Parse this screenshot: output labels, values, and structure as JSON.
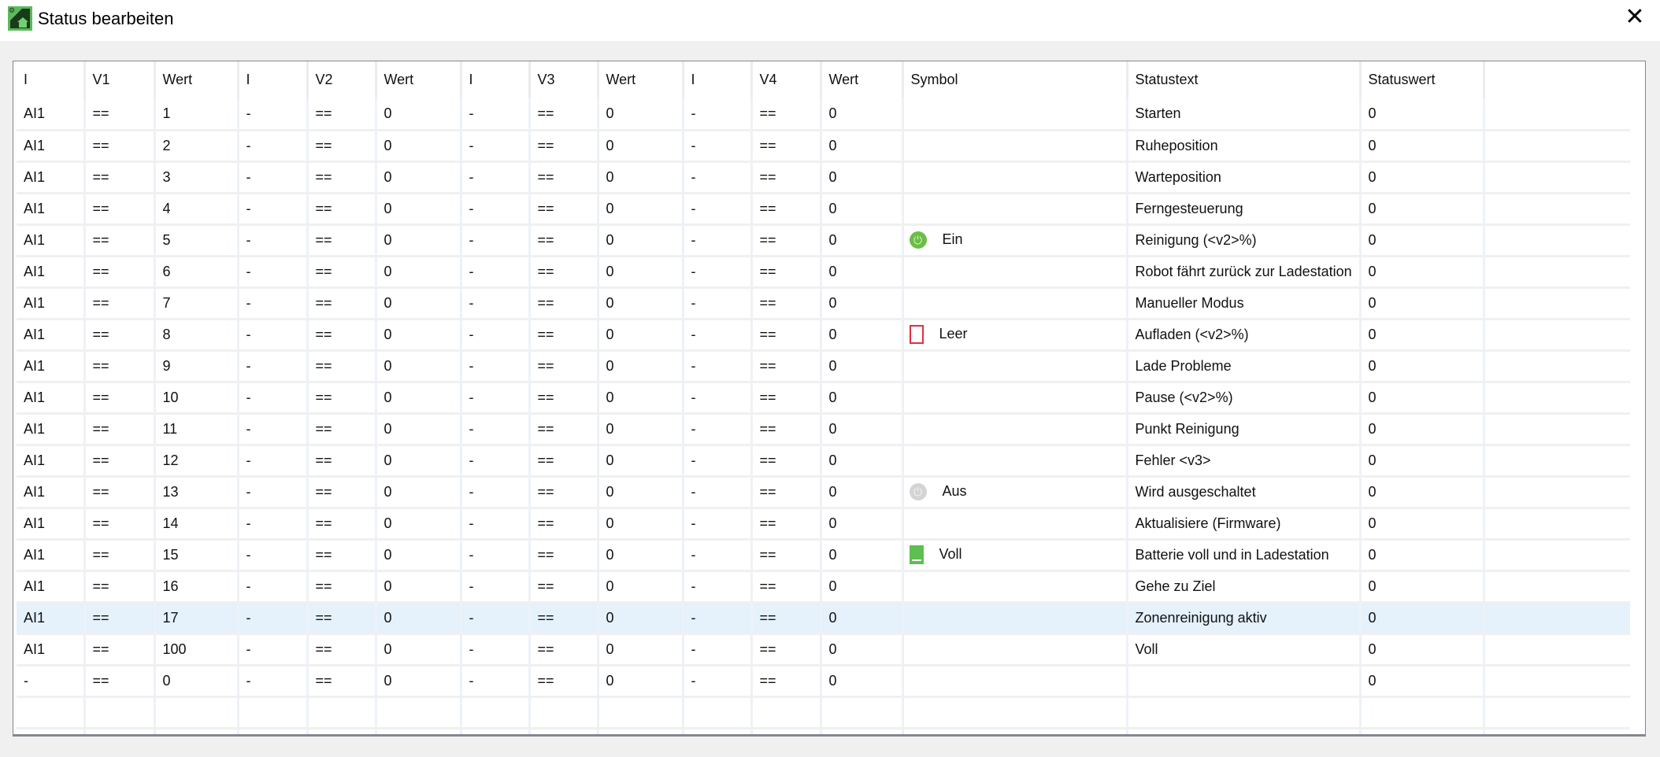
{
  "window": {
    "title": "Status bearbeiten",
    "close_icon": "close-icon"
  },
  "colors": {
    "selected_row": "#e5f1fb",
    "power_on": "#6abf45",
    "battery_empty": "#e03040",
    "battery_full": "#5cbf50"
  },
  "columns": [
    "I",
    "V1",
    "Wert",
    "I",
    "V2",
    "Wert",
    "I",
    "V3",
    "Wert",
    "I",
    "V4",
    "Wert",
    "Symbol",
    "Statustext",
    "Statuswert",
    ""
  ],
  "selected_row": 16,
  "rows": [
    {
      "cells": [
        "AI1",
        "==",
        "1",
        "-",
        "==",
        "0",
        "-",
        "==",
        "0",
        "-",
        "==",
        "0"
      ],
      "symbol": null,
      "text": "Starten",
      "value": "0"
    },
    {
      "cells": [
        "AI1",
        "==",
        "2",
        "-",
        "==",
        "0",
        "-",
        "==",
        "0",
        "-",
        "==",
        "0"
      ],
      "symbol": null,
      "text": "Ruheposition",
      "value": "0"
    },
    {
      "cells": [
        "AI1",
        "==",
        "3",
        "-",
        "==",
        "0",
        "-",
        "==",
        "0",
        "-",
        "==",
        "0"
      ],
      "symbol": null,
      "text": "Warteposition",
      "value": "0"
    },
    {
      "cells": [
        "AI1",
        "==",
        "4",
        "-",
        "==",
        "0",
        "-",
        "==",
        "0",
        "-",
        "==",
        "0"
      ],
      "symbol": null,
      "text": "Ferngesteuerung",
      "value": "0"
    },
    {
      "cells": [
        "AI1",
        "==",
        "5",
        "-",
        "==",
        "0",
        "-",
        "==",
        "0",
        "-",
        "==",
        "0"
      ],
      "symbol": {
        "icon": "power-on",
        "label": "Ein"
      },
      "text": "Reinigung (<v2>%)",
      "value": "0"
    },
    {
      "cells": [
        "AI1",
        "==",
        "6",
        "-",
        "==",
        "0",
        "-",
        "==",
        "0",
        "-",
        "==",
        "0"
      ],
      "symbol": null,
      "text": "Robot fährt zurück zur Ladestation",
      "value": "0"
    },
    {
      "cells": [
        "AI1",
        "==",
        "7",
        "-",
        "==",
        "0",
        "-",
        "==",
        "0",
        "-",
        "==",
        "0"
      ],
      "symbol": null,
      "text": "Manueller Modus",
      "value": "0"
    },
    {
      "cells": [
        "AI1",
        "==",
        "8",
        "-",
        "==",
        "0",
        "-",
        "==",
        "0",
        "-",
        "==",
        "0"
      ],
      "symbol": {
        "icon": "battery-empty",
        "label": "Leer"
      },
      "text": "Aufladen (<v2>%)",
      "value": "0"
    },
    {
      "cells": [
        "AI1",
        "==",
        "9",
        "-",
        "==",
        "0",
        "-",
        "==",
        "0",
        "-",
        "==",
        "0"
      ],
      "symbol": null,
      "text": "Lade Probleme",
      "value": "0"
    },
    {
      "cells": [
        "AI1",
        "==",
        "10",
        "-",
        "==",
        "0",
        "-",
        "==",
        "0",
        "-",
        "==",
        "0"
      ],
      "symbol": null,
      "text": "Pause (<v2>%)",
      "value": "0"
    },
    {
      "cells": [
        "AI1",
        "==",
        "11",
        "-",
        "==",
        "0",
        "-",
        "==",
        "0",
        "-",
        "==",
        "0"
      ],
      "symbol": null,
      "text": "Punkt Reinigung",
      "value": "0"
    },
    {
      "cells": [
        "AI1",
        "==",
        "12",
        "-",
        "==",
        "0",
        "-",
        "==",
        "0",
        "-",
        "==",
        "0"
      ],
      "symbol": null,
      "text": "Fehler <v3>",
      "value": "0"
    },
    {
      "cells": [
        "AI1",
        "==",
        "13",
        "-",
        "==",
        "0",
        "-",
        "==",
        "0",
        "-",
        "==",
        "0"
      ],
      "symbol": {
        "icon": "power-off",
        "label": "Aus"
      },
      "text": "Wird ausgeschaltet",
      "value": "0"
    },
    {
      "cells": [
        "AI1",
        "==",
        "14",
        "-",
        "==",
        "0",
        "-",
        "==",
        "0",
        "-",
        "==",
        "0"
      ],
      "symbol": null,
      "text": "Aktualisiere (Firmware)",
      "value": "0"
    },
    {
      "cells": [
        "AI1",
        "==",
        "15",
        "-",
        "==",
        "0",
        "-",
        "==",
        "0",
        "-",
        "==",
        "0"
      ],
      "symbol": {
        "icon": "battery-full",
        "label": "Voll"
      },
      "text": "Batterie voll und in Ladestation",
      "value": "0"
    },
    {
      "cells": [
        "AI1",
        "==",
        "16",
        "-",
        "==",
        "0",
        "-",
        "==",
        "0",
        "-",
        "==",
        "0"
      ],
      "symbol": null,
      "text": "Gehe zu Ziel",
      "value": "0"
    },
    {
      "cells": [
        "AI1",
        "==",
        "17",
        "-",
        "==",
        "0",
        "-",
        "==",
        "0",
        "-",
        "==",
        "0"
      ],
      "symbol": null,
      "text": "Zonenreinigung aktiv",
      "value": "0"
    },
    {
      "cells": [
        "AI1",
        "==",
        "100",
        "-",
        "==",
        "0",
        "-",
        "==",
        "0",
        "-",
        "==",
        "0"
      ],
      "symbol": null,
      "text": "Voll",
      "value": "0"
    },
    {
      "cells": [
        "-",
        "==",
        "0",
        "-",
        "==",
        "0",
        "-",
        "==",
        "0",
        "-",
        "==",
        "0"
      ],
      "symbol": null,
      "text": "",
      "value": "0"
    }
  ],
  "empty_rows": 2
}
